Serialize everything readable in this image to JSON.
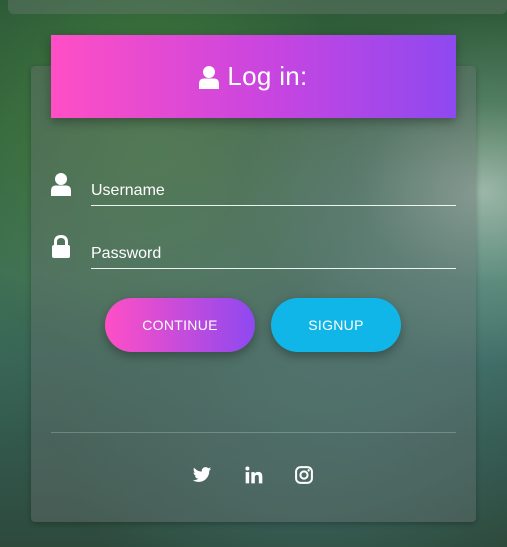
{
  "header": {
    "title": "Log in:",
    "icon": "user-icon"
  },
  "form": {
    "username": {
      "placeholder": "Username",
      "value": "",
      "icon": "user-icon"
    },
    "password": {
      "placeholder": "Password",
      "value": "",
      "icon": "lock-icon"
    }
  },
  "buttons": {
    "continue_label": "CONTINUE",
    "signup_label": "SIGNUP"
  },
  "social": [
    "twitter-icon",
    "linkedin-icon",
    "instagram-icon"
  ],
  "colors": {
    "gradient_start": "#ff4fc5",
    "gradient_end": "#8e49f0",
    "signup": "#10b6e8",
    "text": "#ffffff"
  }
}
